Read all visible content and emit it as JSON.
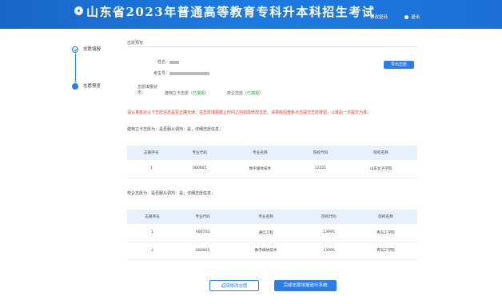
{
  "header": {
    "title": "山东省2023年普通高等教育专科升本科招生考试",
    "edit_pwd": "修改密码",
    "logout": "退出"
  },
  "steps": [
    {
      "label": "志愿填报"
    },
    {
      "label": "志愿预览"
    }
  ],
  "panel": {
    "title": "志愿预览",
    "name_label": "姓名：",
    "exam_no_label": "考生号：",
    "status_label": "志愿填报状态：",
    "status_jianda_label": "建档立卡志愿（",
    "status_jianda_value": "已填报",
    "status_jianda_close": "）",
    "status_xiaoqi_label": "校企志愿（",
    "status_xiaoqi_value": "已填报",
    "status_xiaoqi_close": "）",
    "export_button": "导出志愿"
  },
  "notice": "请认真核对以下志愿信息是否正确无误，在志愿填报截止时间之前如需修改志愿，请将收回重新点击提交志愿按钮，以最后一次提交为准。",
  "section1_title": "建档立卡志愿为：是否服从调剂：是，详细志愿信息：",
  "section2_title": "校企志愿为：是否服从调剂：是，详细志愿信息：",
  "table_headers": [
    "志愿序号",
    "专业代码",
    "专业名称",
    "院校代码",
    "院校名称"
  ],
  "table1_rows": [
    [
      "1",
      "080905",
      "数字媒体技术",
      "12221",
      "山东女子学院"
    ]
  ],
  "table2_rows": [
    [
      "1",
      "080703",
      "通信工程",
      "13995",
      "青岛工学院"
    ],
    [
      "2",
      "080905",
      "数字媒体技术",
      "13995",
      "青岛工学院"
    ]
  ],
  "buttons": {
    "back": "返回修改志愿",
    "done": "完成志愿填报退出系统"
  },
  "colors": {
    "header_blue": "#1c7be0",
    "accent": "#2b7de9",
    "notice_red": "#e53935",
    "status_green": "#1ea832",
    "table_header_bg": "#e7f0fb"
  }
}
